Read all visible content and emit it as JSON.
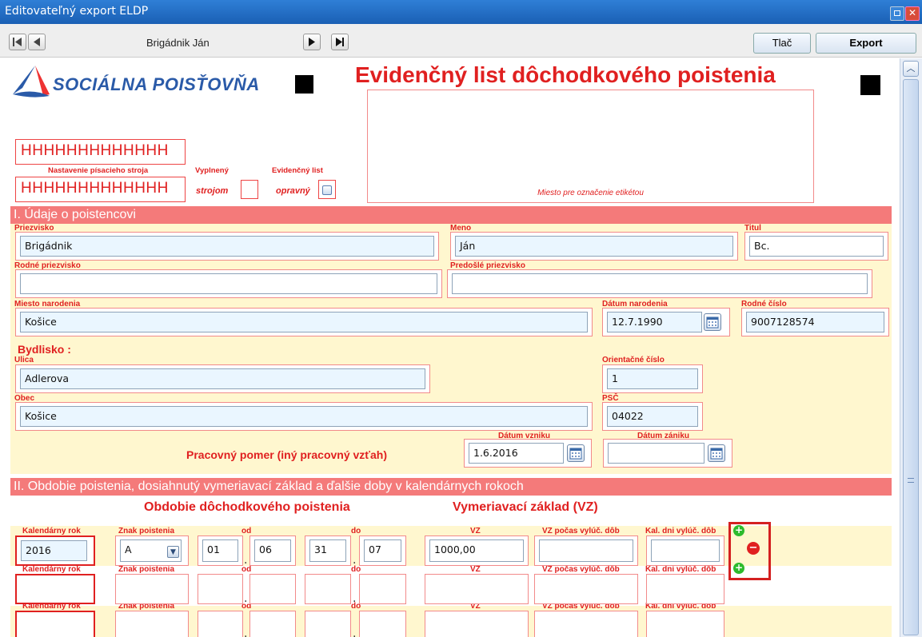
{
  "window": {
    "title": "Editovateľný export ELDP"
  },
  "toolbar": {
    "person_name": "Brigádnik Ján",
    "print_label": "Tlač",
    "export_label": "Export"
  },
  "header": {
    "logo_text": "SOCIÁLNA POISŤOVŇA",
    "doc_title": "Evidenčný list dôchodkového poistenia",
    "typewriter_test_1": "HHHHHHHHHHHHH",
    "typewriter_test_2": "HHHHHHHHHHHHH",
    "typewriter_label": "Nastavenie písacieho stroja",
    "filled_label": "Vyplnený",
    "filled_sub": "strojom",
    "record_label": "Evidenčný list",
    "record_sub": "opravný",
    "label_area": "Miesto pre označenie etikétou"
  },
  "section1": {
    "title": "I. Údaje o poistencovi",
    "surname_label": "Priezvisko",
    "surname": "Brigádnik",
    "name_label": "Meno",
    "name": "Ján",
    "title_label": "Titul",
    "title_value": "Bc.",
    "birth_surname_label": "Rodné priezvisko",
    "birth_surname": "",
    "prev_surname_label": "Predošlé priezvisko",
    "prev_surname": "",
    "birthplace_label": "Miesto narodenia",
    "birthplace": "Košice",
    "birthdate_label": "Dátum narodenia",
    "birthdate": "12.7.1990",
    "birthnum_label": "Rodné číslo",
    "birthnum": "9007128574",
    "address_label": "Bydlisko :",
    "street_label": "Ulica",
    "street": "Adlerova",
    "housenum_label": "Orientačné číslo",
    "housenum": "1",
    "city_label": "Obec",
    "city": "Košice",
    "zip_label": "PSČ",
    "zip": "04022",
    "employment_label": "Pracovný pomer (iný pracovný vzťah)",
    "start_label": "Dátum vzniku",
    "start": "1.6.2016",
    "end_label": "Dátum zániku",
    "end": ""
  },
  "section2": {
    "title": "II. Obdobie poistenia, dosiahnutý vymeriavací základ a ďalšie doby v kalendárnych rokoch",
    "period_heading": "Obdobie dôchodkového poistenia",
    "base_heading": "Vymeriavací základ (VZ)",
    "col_year": "Kalendárny rok",
    "col_sign": "Znak poistenia",
    "col_from": "od",
    "col_to": "do",
    "col_vz": "VZ",
    "col_vz_excl": "VZ počas vylúč. dôb",
    "col_days_excl": "Kal. dni vylúč. dôb",
    "row1": {
      "year": "2016",
      "sign": "A",
      "from_d": "01",
      "from_m": "06",
      "to_d": "31",
      "to_m": "07",
      "vz": "1000,00",
      "vz_excl": "",
      "days_excl": ""
    }
  }
}
